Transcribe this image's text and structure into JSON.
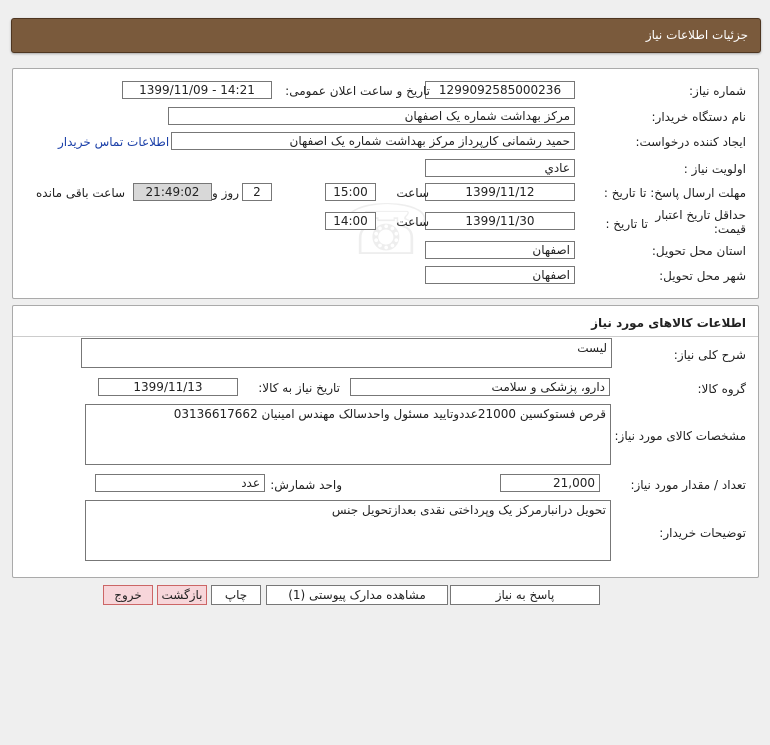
{
  "header": {
    "title": "جزئیات اطلاعات نیاز"
  },
  "info": {
    "need_number_label": "شماره نیاز:",
    "need_number": "1299092585000236",
    "announce_label": "تاریخ و ساعت اعلان عمومی:",
    "announce_value": "1399/11/09 - 14:21",
    "buyer_org_label": "نام دستگاه خریدار:",
    "buyer_org": "مرکز بهداشت شماره یک اصفهان",
    "requester_label": "ایجاد کننده درخواست:",
    "requester": "حمید رشمانی کارپرداز مرکز بهداشت شماره یک اصفهان",
    "contact_link": "اطلاعات تماس خریدار",
    "priority_label": "اولویت نیاز :",
    "priority": "عادي",
    "deadline_label": "مهلت ارسال پاسخ: تا تاریخ :",
    "deadline_date": "1399/11/12",
    "time_label": "ساعت",
    "deadline_time": "15:00",
    "days_value": "2",
    "days_label": "روز و",
    "remaining_time": "21:49:02",
    "remaining_label": "ساعت باقی مانده",
    "validity_label": "حداقل تاریخ اعتبار قیمت:",
    "validity_to_label": "تا تاریخ :",
    "validity_date": "1399/11/30",
    "validity_time_label": "ساعت",
    "validity_time": "14:00",
    "province_label": "استان محل تحویل:",
    "province": "اصفهان",
    "city_label": "شهر محل تحویل:",
    "city": "اصفهان"
  },
  "goods": {
    "section_title": "اطلاعات کالاهای مورد نیاز",
    "desc_label": "شرح کلی نیاز:",
    "desc": "لیست",
    "group_label": "گروه کالا:",
    "group": "دارو، پزشکی و سلامت",
    "need_date_label": "تاریخ نیاز به کالا:",
    "need_date": "1399/11/13",
    "specs_label": "مشخصات کالای مورد نیاز:",
    "specs": "قرص فستوکسین 21000عددوتایید مسئول واحدسالک مهندس امینیان 03136617662",
    "qty_label": "تعداد / مقدار مورد نیاز:",
    "qty": "21,000",
    "unit_label": "واحد شمارش:",
    "unit": "عدد",
    "notes_label": "توضیحات خریدار:",
    "notes": "تحویل درانبارمرکز یک وپرداختی نقدی بعدازتحویل جنس"
  },
  "buttons": {
    "respond": "پاسخ به نیاز",
    "attachments": "مشاهده مدارک پیوستی (1)",
    "print": "چاپ",
    "back": "بازگشت",
    "exit": "خروج"
  }
}
